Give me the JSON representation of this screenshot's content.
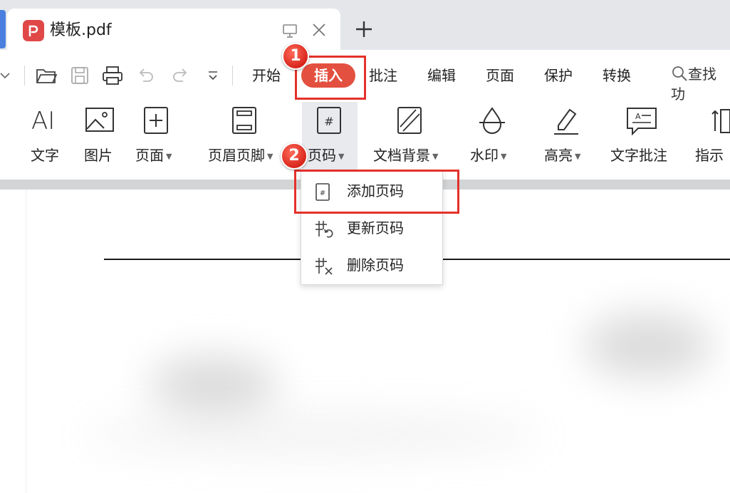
{
  "tab": {
    "title": "模板.pdf",
    "logo_glyph": "P"
  },
  "menu": {
    "items": [
      "开始",
      "插入",
      "批注",
      "编辑",
      "页面",
      "保护",
      "转换"
    ],
    "active": "插入",
    "search_label": "查找功"
  },
  "ribbon": {
    "tools": [
      {
        "label": "文字",
        "icon": "text-tool-icon",
        "has_caret": false
      },
      {
        "label": "图片",
        "icon": "image-icon",
        "has_caret": false
      },
      {
        "label": "页面",
        "icon": "add-page-icon",
        "has_caret": true
      },
      {
        "label": "页眉页脚",
        "icon": "header-footer-icon",
        "has_caret": true
      },
      {
        "label": "页码",
        "icon": "page-number-icon",
        "has_caret": true
      },
      {
        "label": "文档背景",
        "icon": "background-icon",
        "has_caret": true
      },
      {
        "label": "水印",
        "icon": "watermark-icon",
        "has_caret": true
      },
      {
        "label": "高亮",
        "icon": "highlight-icon",
        "has_caret": true
      },
      {
        "label": "文字批注",
        "icon": "text-comment-icon",
        "has_caret": false
      },
      {
        "label": "指示",
        "icon": "pointer-icon",
        "has_caret": false
      }
    ],
    "text_tool_glyph": "AI"
  },
  "dropdown": {
    "items": [
      {
        "label": "添加页码",
        "icon": "add-page-number-icon"
      },
      {
        "label": "更新页码",
        "icon": "update-page-number-icon"
      },
      {
        "label": "删除页码",
        "icon": "delete-page-number-icon"
      }
    ]
  },
  "callouts": {
    "step1": "1",
    "step2": "2"
  },
  "colors": {
    "accent": "#e3503f",
    "callout": "#e4312b",
    "tab_bar": "#e4e6ea",
    "left_accent": "#4a7fe0"
  }
}
